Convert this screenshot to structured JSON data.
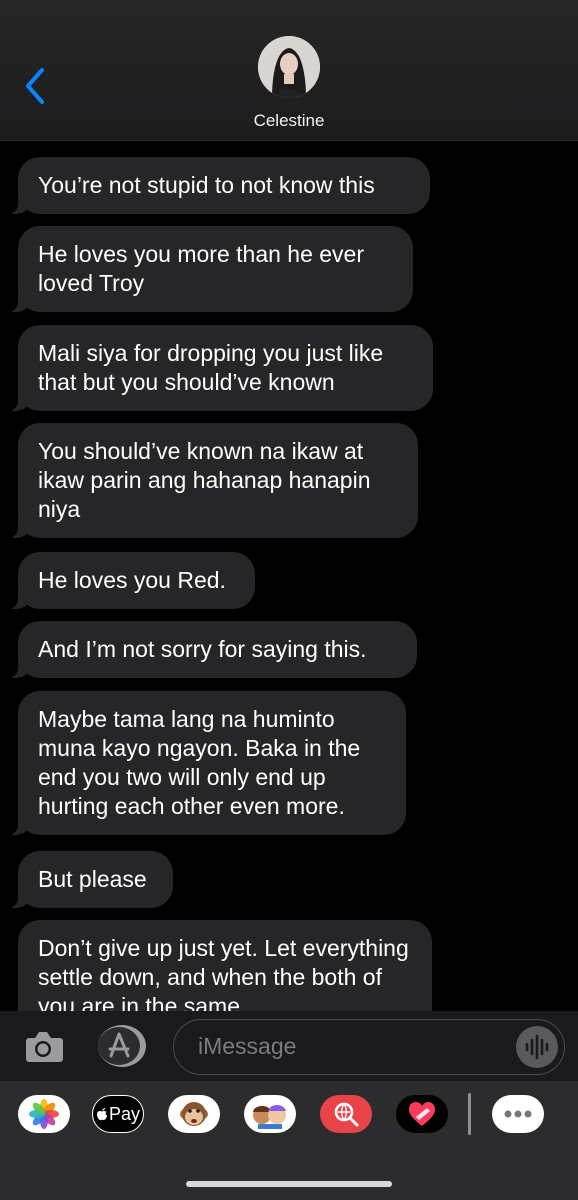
{
  "header": {
    "contact_name": "Celestine"
  },
  "messages": [
    "You’re not stupid to not know this",
    "He loves you more than he ever loved Troy",
    "Mali siya for dropping you just like that but you should’ve known",
    "You should’ve known na ikaw at ikaw parin ang hahanap hanapin niya",
    "He loves you Red.",
    "And I’m not sorry for saying this.",
    "Maybe tama lang na huminto muna kayo ngayon. Baka in the end you two will only end up hurting each other even more.",
    "But please",
    "Don’t give up just yet. Let everything settle down, and when the both of you are in the same"
  ],
  "input": {
    "placeholder": "iMessage"
  },
  "apps": [
    {
      "name": "photos-icon"
    },
    {
      "name": "apple-pay-icon",
      "label": "Pay"
    },
    {
      "name": "animoji-icon"
    },
    {
      "name": "memoji-icon"
    },
    {
      "name": "web-search-icon"
    },
    {
      "name": "digital-touch-icon"
    },
    {
      "name": "more-apps-icon"
    }
  ],
  "colors": {
    "accent": "#0a84ff",
    "bubble": "#262629",
    "background": "#000000"
  }
}
